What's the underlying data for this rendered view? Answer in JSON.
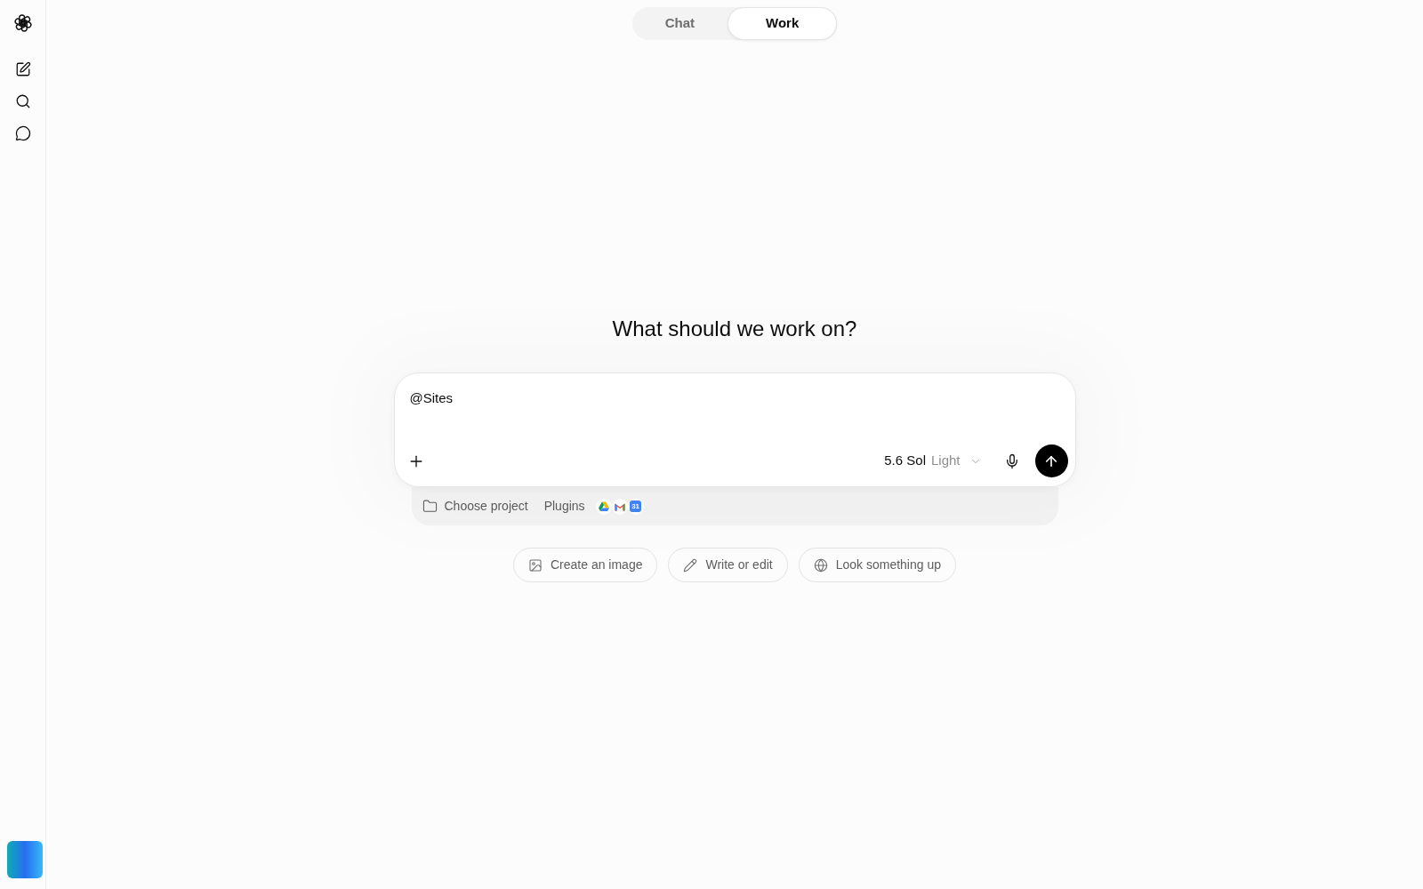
{
  "mode_tabs": [
    {
      "label": "Chat",
      "selected": false
    },
    {
      "label": "Work",
      "selected": true
    }
  ],
  "heading": "What should we work on?",
  "composer": {
    "value": "@Sites",
    "model": "5.6 Sol",
    "effort": "Light"
  },
  "composer_footer": {
    "project": "Choose project",
    "plugins": "Plugins",
    "apps": [
      {
        "kind": "drive"
      },
      {
        "kind": "mail"
      },
      {
        "kind": "calendar",
        "day": "31"
      }
    ]
  },
  "suggestions": [
    {
      "label": "Create an image",
      "kind": "image"
    },
    {
      "label": "Write or edit",
      "kind": "pencil"
    },
    {
      "label": "Look something up",
      "kind": "globe"
    }
  ]
}
